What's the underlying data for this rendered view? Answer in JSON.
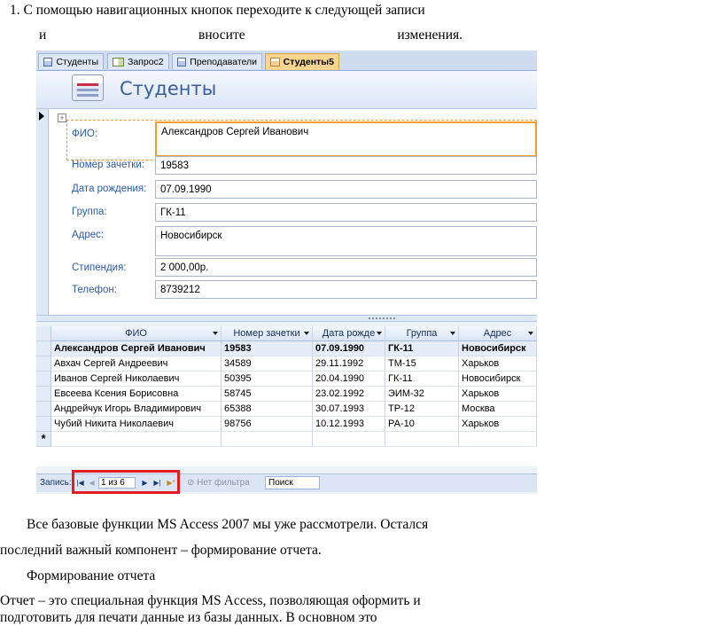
{
  "doc": {
    "line1": "1.  С помощью навигационных кнопок переходите к следующей записи",
    "line2_words": [
      "и",
      "вносите",
      "изменения."
    ],
    "para1_line1": "Все базовые функции MS Access 2007 мы уже рассмотрели. Остался",
    "para1_line2": "последний важный компонент – формирование отчета.",
    "heading": "Формирование отчета",
    "para2_line1": "Отчет – это специальная функция MS Access, позволяющая оформить и",
    "para2_line2": "подготовить для печати данные из базы данных. В основном это"
  },
  "access": {
    "tabs": [
      {
        "label": "Студенты",
        "icon": "table-icon"
      },
      {
        "label": "Запрос2",
        "icon": "query-icon"
      },
      {
        "label": "Преподаватели",
        "icon": "table-icon"
      },
      {
        "label": "Студенты5",
        "icon": "form-icon",
        "active": true
      }
    ],
    "form_title": "Студенты",
    "fields": [
      {
        "label": "ФИО:",
        "value": "Александров Сергей Иванович"
      },
      {
        "label": "Номер зачетки:",
        "value": "19583"
      },
      {
        "label": "Дата рождения:",
        "value": "07.09.1990"
      },
      {
        "label": "Группа:",
        "value": "ГК-11"
      },
      {
        "label": "Адрес:",
        "value": "Новосибирск"
      },
      {
        "label": "Стипендия:",
        "value": "2 000,00р."
      },
      {
        "label": "Телефон:",
        "value": "8739212"
      }
    ],
    "datasheet": {
      "columns": [
        "ФИО",
        "Номер зачетки",
        "Дата рожде",
        "Группа",
        "Адрес"
      ],
      "rows": [
        [
          "Александров Сергей Иванович",
          "19583",
          "07.09.1990",
          "ГК-11",
          "Новосибирск"
        ],
        [
          "Авхач Сергей Андреевич",
          "34589",
          "29.11.1992",
          "ТМ-15",
          "Харьков"
        ],
        [
          "Иванов Сергей Николаевич",
          "50395",
          "20.04.1990",
          "ГК-11",
          "Новосибирск"
        ],
        [
          "Евсеева Ксения Борисовна",
          "58745",
          "23.02.1992",
          "ЭИМ-32",
          "Харьков"
        ],
        [
          "Андрейчук Игорь Владимирович",
          "65388",
          "30.07.1993",
          "ТР-12",
          "Москва"
        ],
        [
          "Чубий Никита Николаевич",
          "98756",
          "10.12.1993",
          "РА-10",
          "Харьков"
        ]
      ],
      "new_row_marker": "*"
    },
    "nav": {
      "label": "Запись:",
      "first": "|◀",
      "prev": "◀",
      "record": "1 из 6",
      "next": "▶",
      "last": "▶|",
      "new": "▶*",
      "filter": "Нет фильтра",
      "search": "Поиск"
    }
  }
}
